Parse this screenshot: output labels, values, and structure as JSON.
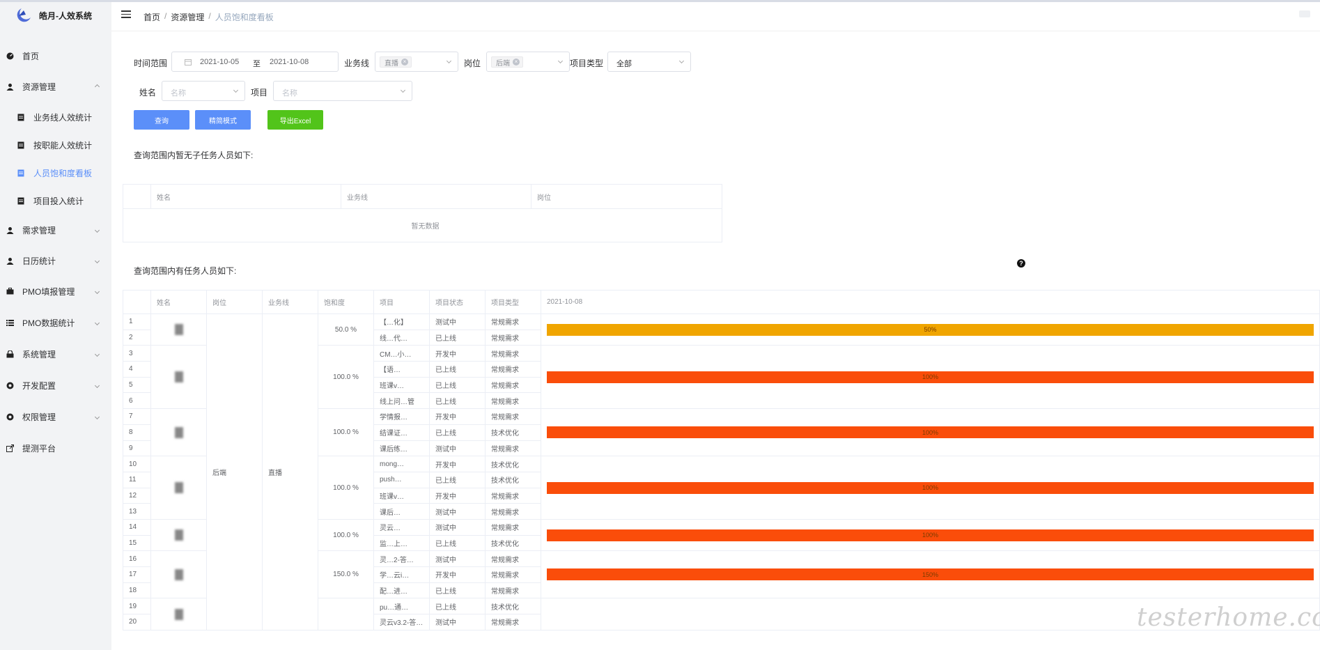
{
  "app": {
    "title": "皓月-人效系统"
  },
  "sidebar": {
    "items": [
      {
        "label": "首页",
        "icon": "dashboard-icon"
      },
      {
        "label": "资源管理",
        "icon": "user-icon",
        "expanded": true
      },
      {
        "label": "业务线人效统计",
        "icon": "document-icon"
      },
      {
        "label": "按职能人效统计",
        "icon": "document-icon"
      },
      {
        "label": "人员饱和度看板",
        "icon": "document-icon",
        "active": true
      },
      {
        "label": "项目投入统计",
        "icon": "document-icon"
      },
      {
        "label": "需求管理",
        "icon": "user-icon"
      },
      {
        "label": "日历统计",
        "icon": "user-icon"
      },
      {
        "label": "PMO填报管理",
        "icon": "briefcase-icon"
      },
      {
        "label": "PMO数据统计",
        "icon": "list-icon"
      },
      {
        "label": "系统管理",
        "icon": "lock-icon"
      },
      {
        "label": "开发配置",
        "icon": "gear-icon"
      },
      {
        "label": "权限管理",
        "icon": "gear-icon"
      },
      {
        "label": "提测平台",
        "icon": "external-link-icon"
      }
    ]
  },
  "breadcrumb": {
    "home": "首页",
    "section": "资源管理",
    "current": "人员饱和度看板"
  },
  "filters": {
    "time_label": "时间范围",
    "date_start": "2021-10-05",
    "date_sep": "至",
    "date_end": "2021-10-08",
    "business_label": "业务线",
    "business_tag": "直播",
    "post_label": "岗位",
    "post_tag": "后端",
    "type_label": "项目类型",
    "type_value": "全部",
    "name_label": "姓名",
    "name_placeholder": "名称",
    "project_label": "项目",
    "project_placeholder": "名称"
  },
  "buttons": {
    "query": "查询",
    "simple": "精简模式",
    "export": "导出Excel"
  },
  "idle_section": {
    "title": "查询范围内暂无子任务人员如下:",
    "headers": [
      "姓名",
      "业务线",
      "岗位"
    ],
    "empty_text": "暂无数据"
  },
  "busy_section": {
    "title": "查询范围内有任务人员如下:",
    "headers": [
      "姓名",
      "岗位",
      "业务线",
      "饱和度",
      "项目",
      "项目状态",
      "项目类型",
      "2021-10-08"
    ],
    "post": "后端",
    "business": "直播",
    "groups": [
      {
        "saturation": "50.0 %",
        "bar_label": "50%",
        "bar_color": "#f0a500",
        "rows": [
          {
            "idx": "1",
            "project": "【…化】",
            "status": "测试中",
            "type": "常规需求"
          },
          {
            "idx": "2",
            "project": "线…代…",
            "status": "已上线",
            "type": "常规需求"
          }
        ]
      },
      {
        "saturation": "100.0 %",
        "bar_label": "100%",
        "bar_color": "#fa4d0a",
        "rows": [
          {
            "idx": "3",
            "project": "CM…小…",
            "status": "开发中",
            "type": "常规需求"
          },
          {
            "idx": "4",
            "project": "【语…",
            "status": "已上线",
            "type": "常规需求"
          },
          {
            "idx": "5",
            "project": "班课v…",
            "status": "已上线",
            "type": "常规需求"
          },
          {
            "idx": "6",
            "project": "线上问…管",
            "status": "已上线",
            "type": "常规需求"
          }
        ]
      },
      {
        "saturation": "100.0 %",
        "bar_label": "100%",
        "bar_color": "#fa4d0a",
        "rows": [
          {
            "idx": "7",
            "project": "学情报…",
            "status": "开发中",
            "type": "常规需求"
          },
          {
            "idx": "8",
            "project": "结课证…",
            "status": "已上线",
            "type": "技术优化"
          },
          {
            "idx": "9",
            "project": "课后练…",
            "status": "测试中",
            "type": "常规需求"
          }
        ]
      },
      {
        "saturation": "100.0 %",
        "bar_label": "100%",
        "bar_color": "#fa4d0a",
        "rows": [
          {
            "idx": "10",
            "project": "mong…",
            "status": "开发中",
            "type": "技术优化"
          },
          {
            "idx": "11",
            "project": "push…",
            "status": "已上线",
            "type": "技术优化"
          },
          {
            "idx": "12",
            "project": "班课v…",
            "status": "开发中",
            "type": "常规需求"
          },
          {
            "idx": "13",
            "project": "课后…",
            "status": "测试中",
            "type": "常规需求"
          }
        ]
      },
      {
        "saturation": "100.0 %",
        "bar_label": "100%",
        "bar_color": "#fa4d0a",
        "rows": [
          {
            "idx": "14",
            "project": "灵云…",
            "status": "测试中",
            "type": "常规需求"
          },
          {
            "idx": "15",
            "project": "监…上…",
            "status": "已上线",
            "type": "技术优化"
          }
        ]
      },
      {
        "saturation": "150.0 %",
        "bar_label": "150%",
        "bar_color": "#fa4d0a",
        "rows": [
          {
            "idx": "16",
            "project": "灵…2-答…",
            "status": "测试中",
            "type": "常规需求"
          },
          {
            "idx": "17",
            "project": "学…云i…",
            "status": "开发中",
            "type": "常规需求"
          },
          {
            "idx": "18",
            "project": "配…进…",
            "status": "已上线",
            "type": "常规需求"
          }
        ]
      },
      {
        "saturation": "",
        "bar_label": "",
        "bar_color": "",
        "rows": [
          {
            "idx": "19",
            "project": "pu…通…",
            "status": "已上线",
            "type": "技术优化"
          },
          {
            "idx": "20",
            "project": "灵云v3.2-答…",
            "status": "测试中",
            "type": "常规需求"
          }
        ]
      }
    ]
  },
  "watermark": "testerhome.com"
}
